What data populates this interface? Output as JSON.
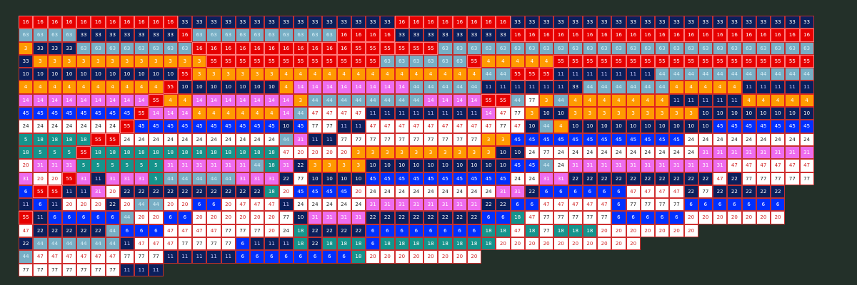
{
  "board": {
    "rows": [
      [
        16,
        16,
        16,
        16,
        16,
        16,
        16,
        16,
        16,
        16,
        16,
        33,
        33,
        33,
        33,
        33,
        33,
        33,
        33,
        33,
        33,
        33,
        33,
        33,
        33,
        33,
        16,
        16,
        16,
        16,
        16,
        16,
        16,
        16,
        33,
        33,
        33,
        33,
        33,
        33,
        33,
        33,
        33,
        33,
        33,
        33,
        33,
        33,
        33,
        33,
        33,
        33,
        33,
        33,
        33
      ],
      [
        63,
        63,
        63,
        63,
        33,
        33,
        33,
        33,
        33,
        33,
        33,
        16,
        63,
        63,
        63,
        63,
        63,
        63,
        63,
        63,
        63,
        63,
        16,
        16,
        16,
        16,
        33,
        33,
        33,
        33,
        33,
        33,
        33,
        33,
        16,
        16,
        16,
        16,
        16,
        16,
        16,
        16,
        16,
        16,
        16,
        16,
        16,
        16,
        16,
        16,
        16,
        16,
        16,
        16,
        16
      ],
      [
        3,
        33,
        33,
        33,
        63,
        63,
        63,
        63,
        63,
        63,
        63,
        63,
        16,
        16,
        16,
        16,
        16,
        16,
        16,
        16,
        16,
        16,
        16,
        55,
        55,
        55,
        55,
        55,
        55,
        63,
        63,
        63,
        63,
        63,
        63,
        63,
        63,
        63,
        63,
        63,
        63,
        63,
        63,
        63,
        63,
        63,
        63,
        63,
        63,
        63,
        63,
        63,
        63,
        63,
        63
      ],
      [
        33,
        3,
        3,
        3,
        3,
        3,
        3,
        3,
        3,
        3,
        3,
        3,
        3,
        55,
        55,
        55,
        55,
        55,
        55,
        55,
        55,
        55,
        55,
        55,
        55,
        63,
        63,
        63,
        63,
        63,
        63,
        55,
        4,
        4,
        4,
        4,
        4,
        55,
        55,
        55,
        55,
        55,
        55,
        55,
        55,
        55,
        55,
        55,
        55,
        55,
        55,
        55,
        55,
        55,
        55
      ],
      [
        10,
        10,
        10,
        10,
        10,
        10,
        10,
        10,
        10,
        10,
        10,
        55,
        3,
        3,
        3,
        3,
        3,
        3,
        4,
        4,
        4,
        4,
        4,
        4,
        4,
        4,
        4,
        4,
        4,
        4,
        4,
        4,
        44,
        44,
        55,
        55,
        55,
        11,
        11,
        11,
        11,
        11,
        11,
        11,
        44,
        44,
        44,
        44,
        44,
        44,
        44,
        44,
        44,
        44,
        44
      ],
      [
        4,
        4,
        4,
        4,
        4,
        4,
        4,
        4,
        4,
        4,
        55,
        10,
        10,
        10,
        10,
        10,
        10,
        10,
        4,
        14,
        14,
        14,
        14,
        14,
        14,
        14,
        14,
        44,
        44,
        44,
        44,
        44,
        11,
        11,
        11,
        11,
        11,
        11,
        33,
        44,
        44,
        44,
        44,
        44,
        44,
        4,
        4,
        4,
        4,
        4,
        11,
        11,
        11,
        11,
        11
      ],
      [
        14,
        14,
        14,
        14,
        14,
        14,
        14,
        14,
        14,
        55,
        4,
        4,
        14,
        14,
        14,
        14,
        14,
        14,
        14,
        3,
        44,
        44,
        44,
        44,
        44,
        44,
        44,
        44,
        14,
        14,
        14,
        14,
        55,
        55,
        44,
        77,
        3,
        44,
        4,
        4,
        4,
        4,
        4,
        4,
        4,
        11,
        11,
        11,
        11,
        11,
        4,
        4,
        4,
        4,
        4
      ],
      [
        45,
        45,
        45,
        45,
        45,
        45,
        45,
        45,
        55,
        14,
        14,
        14,
        4,
        4,
        4,
        4,
        4,
        4,
        14,
        44,
        47,
        47,
        47,
        47,
        11,
        11,
        11,
        11,
        11,
        11,
        11,
        11,
        14,
        47,
        77,
        3,
        10,
        10,
        3,
        3,
        3,
        3,
        3,
        3,
        3,
        3,
        3,
        10,
        10,
        10,
        10,
        10,
        10,
        10,
        10
      ],
      [
        24,
        24,
        24,
        24,
        24,
        24,
        24,
        55,
        45,
        45,
        45,
        45,
        45,
        45,
        45,
        45,
        45,
        45,
        10,
        45,
        77,
        77,
        11,
        11,
        47,
        47,
        47,
        47,
        47,
        47,
        47,
        47,
        47,
        77,
        47,
        10,
        44,
        4,
        10,
        10,
        10,
        10,
        10,
        10,
        10,
        10,
        10,
        10,
        45,
        45,
        45,
        45,
        45,
        45,
        45
      ],
      [
        5,
        18,
        18,
        18,
        18,
        55,
        55,
        24,
        24,
        24,
        24,
        24,
        24,
        24,
        24,
        24,
        24,
        24,
        44,
        31,
        11,
        11,
        77,
        77,
        77,
        77,
        77,
        77,
        77,
        77,
        77,
        77,
        3,
        3,
        45,
        45,
        45,
        45,
        45,
        45,
        45,
        45,
        45,
        45,
        45,
        45,
        24,
        24,
        24,
        24,
        24,
        24,
        24,
        24,
        24
      ],
      [
        18,
        5,
        5,
        5,
        55,
        18,
        18,
        18,
        18,
        18,
        18,
        18,
        18,
        18,
        18,
        18,
        18,
        18,
        47,
        20,
        20,
        20,
        20,
        3,
        3,
        3,
        3,
        3,
        3,
        3,
        3,
        3,
        3,
        10,
        10,
        24,
        77,
        24,
        24,
        24,
        24,
        24,
        24,
        24,
        24,
        24,
        24,
        31,
        31,
        31,
        31,
        31,
        31,
        31,
        31
      ],
      [
        20,
        31,
        31,
        31,
        5,
        5,
        5,
        5,
        5,
        5,
        31,
        31,
        31,
        31,
        31,
        31,
        44,
        18,
        31,
        22,
        3,
        3,
        3,
        3,
        10,
        10,
        10,
        10,
        10,
        10,
        10,
        10,
        10,
        10,
        45,
        45,
        44,
        24,
        31,
        31,
        31,
        31,
        31,
        31,
        31,
        31,
        31,
        31,
        31,
        47,
        47,
        47,
        47,
        47,
        47
      ],
      [
        31,
        20,
        20,
        55,
        31,
        11,
        31,
        31,
        31,
        5,
        44,
        44,
        44,
        44,
        44,
        31,
        31,
        31,
        22,
        77,
        10,
        10,
        10,
        10,
        45,
        45,
        45,
        45,
        45,
        45,
        45,
        45,
        45,
        45,
        24,
        24,
        31,
        31,
        22,
        22,
        22,
        22,
        22,
        22,
        22,
        22,
        22,
        22,
        47,
        22,
        77,
        77,
        77,
        77,
        77
      ],
      [
        6,
        55,
        55,
        11,
        11,
        31,
        20,
        22,
        22,
        22,
        22,
        22,
        22,
        22,
        22,
        22,
        22,
        18,
        20,
        45,
        45,
        45,
        45,
        20,
        24,
        24,
        24,
        24,
        24,
        24,
        24,
        24,
        24,
        31,
        31,
        22,
        6,
        6,
        6,
        6,
        6,
        6,
        47,
        47,
        47,
        47,
        22,
        77,
        22,
        22,
        22,
        22,
        22
      ],
      [
        11,
        6,
        11,
        20,
        20,
        20,
        22,
        20,
        44,
        44,
        20,
        20,
        6,
        6,
        20,
        47,
        47,
        47,
        11,
        24,
        24,
        24,
        24,
        24,
        31,
        31,
        31,
        31,
        31,
        31,
        31,
        31,
        22,
        22,
        6,
        6,
        47,
        47,
        47,
        47,
        47,
        6,
        77,
        77,
        77,
        77,
        6,
        6,
        6,
        6,
        6,
        6,
        6
      ],
      [
        55,
        11,
        6,
        6,
        6,
        6,
        6,
        44,
        20,
        20,
        6,
        6,
        20,
        20,
        20,
        20,
        20,
        20,
        77,
        10,
        31,
        31,
        31,
        31,
        22,
        22,
        22,
        22,
        22,
        22,
        22,
        22,
        6,
        6,
        18,
        47,
        77,
        77,
        77,
        77,
        77,
        6,
        6,
        6,
        6,
        6,
        20,
        20,
        20,
        20,
        20,
        20,
        20
      ],
      [
        47,
        22,
        22,
        22,
        22,
        22,
        44,
        6,
        6,
        6,
        47,
        47,
        47,
        47,
        77,
        77,
        77,
        20,
        24,
        18,
        22,
        22,
        22,
        22,
        6,
        6,
        6,
        6,
        6,
        6,
        6,
        6,
        18,
        18,
        47,
        18,
        77,
        18,
        18,
        18,
        20,
        20,
        20,
        20,
        20,
        20,
        20
      ],
      [
        22,
        44,
        44,
        44,
        44,
        44,
        44,
        11,
        47,
        47,
        47,
        77,
        77,
        77,
        77,
        6,
        11,
        11,
        11,
        18,
        22,
        18,
        18,
        18,
        6,
        18,
        18,
        18,
        18,
        18,
        18,
        18,
        18,
        20,
        20,
        20,
        20,
        20,
        20,
        20,
        20,
        20,
        20
      ],
      [
        44,
        47,
        47,
        47,
        47,
        47,
        47,
        77,
        77,
        77,
        11,
        11,
        11,
        11,
        11,
        6,
        6,
        6,
        6,
        6,
        6,
        6,
        6,
        18,
        20,
        20,
        20,
        20,
        20,
        20,
        20,
        20
      ],
      [
        77,
        77,
        77,
        77,
        77,
        77,
        77,
        11,
        11,
        11
      ]
    ]
  }
}
